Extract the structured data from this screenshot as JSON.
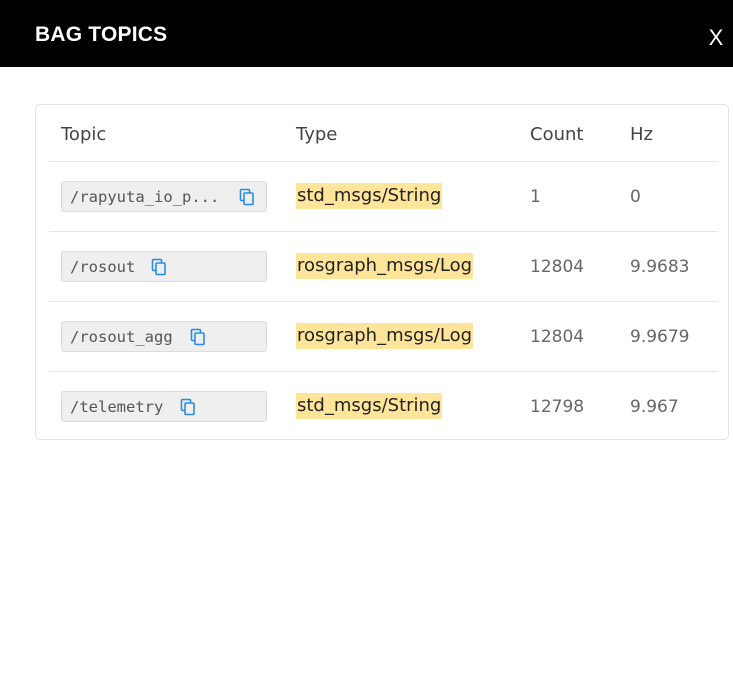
{
  "modal": {
    "title": "BAG TOPICS",
    "close_label": "X"
  },
  "table": {
    "headers": {
      "topic": "Topic",
      "type": "Type",
      "count": "Count",
      "hz": "Hz"
    },
    "rows": [
      {
        "topic": "/rapyuta_io_p...",
        "type": "std_msgs/String",
        "count": "1",
        "hz": "0"
      },
      {
        "topic": "/rosout",
        "type": "rosgraph_msgs/Log",
        "count": "12804",
        "hz": "9.9683"
      },
      {
        "topic": "/rosout_agg",
        "type": "rosgraph_msgs/Log",
        "count": "12804",
        "hz": "9.9679"
      },
      {
        "topic": "/telemetry",
        "type": "std_msgs/String",
        "count": "12798",
        "hz": "9.967"
      }
    ]
  },
  "colors": {
    "header_bg": "#000000",
    "type_highlight": "#ffe599",
    "copy_icon": "#2b8ce6"
  },
  "icons": {
    "copy": "copy-icon"
  }
}
